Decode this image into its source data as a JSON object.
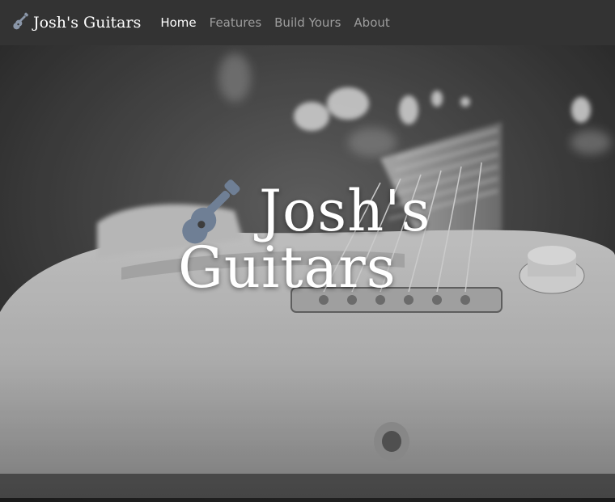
{
  "navbar": {
    "brand_label": "Josh's Guitars",
    "brand_icon": "guitar-icon",
    "links": [
      {
        "label": "Home",
        "active": true
      },
      {
        "label": "Features",
        "active": false
      },
      {
        "label": "Build Yours",
        "active": false
      },
      {
        "label": "About",
        "active": false
      }
    ]
  },
  "hero": {
    "title": "Josh's Guitars",
    "icon": "guitar-icon",
    "icon_color": "#6f7f95",
    "background_image": "black-and-white electric guitar close-up"
  },
  "colors": {
    "navbar_bg": "#333333",
    "nav_active": "#ffffff",
    "nav_inactive": "#9d9d9d"
  }
}
